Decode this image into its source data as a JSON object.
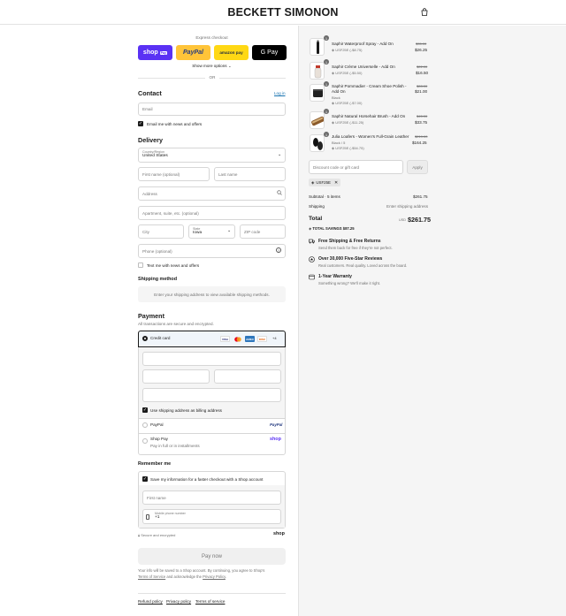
{
  "brand": "BECKETT SIMONON",
  "express": {
    "title": "Express checkout",
    "shop_pay": "shop",
    "shop_pay_badge": "Pay",
    "paypal": "PayPal",
    "amazon": "amazon pay",
    "gpay": "G Pay",
    "more": "Show more options",
    "or": "OR"
  },
  "contact": {
    "title": "Contact",
    "login": "Log in",
    "email_placeholder": "Email",
    "email_news": "Email me with news and offers"
  },
  "delivery": {
    "title": "Delivery",
    "country_label": "Country/Region",
    "country_value": "United States",
    "first_name": "First name (optional)",
    "last_name": "Last name",
    "address": "Address",
    "apartment": "Apartment, suite, etc. (optional)",
    "city": "City",
    "state_label": "State",
    "state_value": "Iowa",
    "zip": "ZIP code",
    "phone": "Phone (optional)",
    "text_news": "Text me with news and offers"
  },
  "shipping": {
    "title": "Shipping method",
    "note": "Enter your shipping address to view available shipping methods."
  },
  "payment": {
    "title": "Payment",
    "subtitle": "All transactions are secure and encrypted.",
    "credit_card": "Credit card",
    "cards": [
      "VISA",
      "MC",
      "AMEX",
      "DISC"
    ],
    "more_cards": "+4",
    "billing_same": "Use shipping address as billing address",
    "paypal": "PayPal",
    "paypal_logo": "PayPal",
    "shop_pay": "Shop Pay",
    "shop_pay_sub": "Pay in full or in installments",
    "shop_logo": "shop"
  },
  "remember": {
    "title": "Remember me",
    "save": "Save my information for a faster checkout with a Shop account",
    "first_name": "First name",
    "mobile_label": "Mobile phone number",
    "mobile_value": "+1",
    "secure": "Secure and encrypted",
    "shop_logo": "shop"
  },
  "pay_now": "Pay now",
  "legal": {
    "line1": "Your info will be saved to a Shop account. By continuing, you agree to Shop's",
    "terms": "Terms of Service",
    "and": "and acknowledge the",
    "privacy": "Privacy Policy",
    "end": "."
  },
  "footer": [
    "Refund policy",
    "Privacy policy",
    "Terms of service"
  ],
  "cart": {
    "items": [
      {
        "qty": "1",
        "name": "Saphir Waterproof Spray - Add On",
        "sub": "",
        "discount": "USF25E (-$8.75)",
        "old": "$35.00",
        "price": "$26.25"
      },
      {
        "qty": "1",
        "name": "Saphir Crème Universelle - Add On",
        "sub": "",
        "discount": "USF25E (-$5.50)",
        "old": "$22.00",
        "price": "$16.50"
      },
      {
        "qty": "1",
        "name": "Saphir Pommadier - Cream Shoe Polish - Add On",
        "sub": "Black",
        "discount": "USF25E (-$7.00)",
        "old": "$28.00",
        "price": "$21.00"
      },
      {
        "qty": "1",
        "name": "Saphir Natural Horsehair Brush - Add On",
        "sub": "",
        "discount": "USF25E (-$11.25)",
        "old": "$45.00",
        "price": "$33.75"
      },
      {
        "qty": "1",
        "name": "Julia Loafers - Women's Full-Grain Leather",
        "sub": "Black / 5",
        "discount": "USF25E (-$54.75)",
        "old": "$219.00",
        "price": "$164.25"
      }
    ],
    "discount_placeholder": "Discount code or gift card",
    "apply": "Apply",
    "code": "USF25E",
    "subtotal_label": "Subtotal · 5 items",
    "subtotal": "$261.75",
    "shipping_label": "Shipping",
    "shipping_value": "Enter shipping address",
    "total_label": "Total",
    "currency": "USD",
    "total": "$261.75",
    "savings": "TOTAL SAVINGS  $87.25"
  },
  "perks": [
    {
      "icon": "truck-icon",
      "title": "Free Shipping & Free Returns",
      "sub": "Send them back for free if they're not perfect."
    },
    {
      "icon": "star-badge-icon",
      "title": "Over 30,000 Five-Star Reviews",
      "sub": "Real customers. Real quality. Loved across the board."
    },
    {
      "icon": "shield-icon",
      "title": "1-Year Warranty",
      "sub": "Something wrong? We'll make it right."
    }
  ],
  "colors": {
    "shop_pay": "#5a31f4",
    "paypal": "#ffc439",
    "amazon": "#ffd814",
    "gpay": "#000000",
    "accent": "#1773b0"
  }
}
